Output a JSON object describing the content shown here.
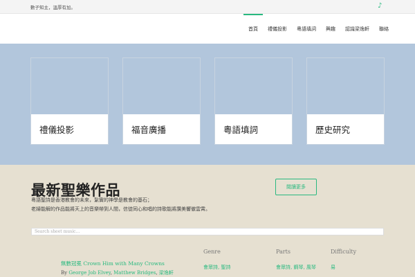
{
  "topbar": {
    "tagline": "數子知主，溫厚有加。",
    "icon": "music-note-icon"
  },
  "nav": {
    "items": [
      {
        "label": "首頁",
        "active": true
      },
      {
        "label": "禮儀投影",
        "active": false
      },
      {
        "label": "粵語填詞",
        "active": false
      },
      {
        "label": "興趣",
        "active": false
      },
      {
        "label": "認識梁逸軒",
        "active": false
      },
      {
        "label": "聯絡",
        "active": false
      }
    ]
  },
  "cards": [
    {
      "label": "禮儀投影"
    },
    {
      "label": "福音廣播"
    },
    {
      "label": "粵語填詞"
    },
    {
      "label": "歷史研究"
    }
  ],
  "works": {
    "title": "最新聖樂作品",
    "line1": "粵語聖詩是香港教會的未來，紮實的神學是教會的基石；",
    "line2": "老婦能解的作品能將天上的音樂帶到人間，信徒同心和唱的詩歌能將讚美響徹雲霄。",
    "read_more": "閱讀更多",
    "search_placeholder": "Search sheet music..."
  },
  "table": {
    "headers": {
      "genre": "Genre",
      "parts": "Parts",
      "difficulty": "Difficulty"
    },
    "entry": {
      "title": "無數冠冕 Crown Him with Many Crowns",
      "by_label": "By",
      "author1": "George Job Elvey",
      "author2": "Matthew Bridges",
      "author3": "梁逸軒",
      "genre1": "會眾詩",
      "genre2": "聖詩",
      "parts1": "會眾詩",
      "parts2": "鋼琴",
      "parts3": "風琴",
      "difficulty": "易"
    }
  },
  "colors": {
    "accent": "#29b97f",
    "feature_bg": "#b2c6dc",
    "works_bg": "#e6e0d1"
  }
}
